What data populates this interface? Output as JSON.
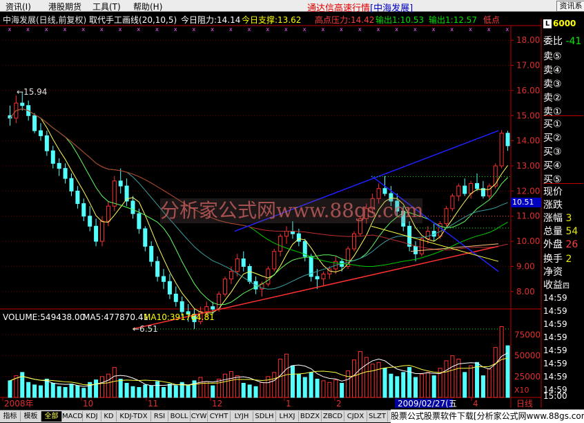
{
  "menu": {
    "items": [
      "资讯(I)",
      "港股期货",
      "工具(T)",
      "帮助(H)"
    ],
    "title_main": "通达信高速行情",
    "title_sub": "[中海发展]",
    "info_btn": "资讯系"
  },
  "chart_header": {
    "name": "中海发展(日线,前复权)",
    "indicator": "取代手工画线(20,10,5)",
    "resist_label": "今日阻力:",
    "resist_val": "14.14",
    "support_label": "今日支撑:",
    "support_val": "13.62",
    "high_label": "高点压力:",
    "high_val": "14.42",
    "out1_label": "输出1:",
    "out1_val": "10.53",
    "out2_label": "输出1:",
    "out2_val": "12.57",
    "low_label": "低点"
  },
  "right_panel": {
    "code": "6000",
    "webi_label": "委比",
    "webi_val": "-41",
    "sells": [
      "卖⑤",
      "卖④",
      "卖③",
      "卖②",
      "卖①"
    ],
    "buys": [
      "买①",
      "买②",
      "买③",
      "买④",
      "买⑤"
    ],
    "stats": [
      {
        "label": "现价",
        "val": ""
      },
      {
        "label": "涨跌",
        "val": ""
      },
      {
        "label": "涨幅",
        "val": "3"
      },
      {
        "label": "总量",
        "val": "54"
      },
      {
        "label": "外盘",
        "val": "26"
      },
      {
        "label": "换手",
        "val": "2"
      },
      {
        "label": "净资",
        "val": ""
      },
      {
        "label": "收益",
        "val": "四"
      }
    ],
    "times": [
      "14:59",
      "14:59",
      "14:59",
      "14:59",
      "14:59",
      "14:59",
      "14:59",
      "14:59",
      "15:00"
    ],
    "price_tag": "10.51"
  },
  "volume_header": {
    "vol_label": "VOLUME:",
    "vol_val": "549438.00",
    "ma5_label": "MA5:",
    "ma5_val": "477870.41",
    "ma10_label": "MA10:",
    "ma10_val": "391764.81"
  },
  "x_axis": {
    "labels": [
      "2008年",
      "10",
      "11",
      "12",
      "1",
      "2",
      "2009/02/27(五",
      "4"
    ],
    "period": "日线"
  },
  "vol_axis": {
    "ticks": [
      "75000",
      "50000",
      "25000"
    ],
    "unit": "X10"
  },
  "tabs": [
    "指标",
    "模板",
    "全部",
    "MACD",
    "KDJ",
    "KD",
    "KDJ-TDX",
    "RSI",
    "BOLL",
    "CYW",
    "CYHT",
    "LYJH",
    "SDLH",
    "LHXJ",
    "BDZX",
    "ZBCD",
    "CJDX",
    "SLZT"
  ],
  "ad_text": "股票公式股票软件下载[分析家公式网www.88gs.com]",
  "watermark_text": "分析家公式网www.88gs.com",
  "chart_data": {
    "type": "candlestick",
    "title": "中海发展(日线,前复权)",
    "ylim": [
      7.5,
      18.5
    ],
    "yticks": [
      18,
      17,
      16,
      15,
      14,
      13,
      12,
      11,
      10,
      9,
      8
    ],
    "annotations": [
      {
        "text": "15.94",
        "kind": "high"
      },
      {
        "text": "6.51",
        "kind": "low"
      }
    ],
    "ohlc": [
      [
        15.0,
        15.4,
        14.6,
        14.9
      ],
      [
        14.9,
        15.8,
        14.7,
        15.5
      ],
      [
        15.5,
        15.94,
        15.2,
        15.4
      ],
      [
        15.4,
        15.6,
        14.8,
        15.0
      ],
      [
        15.0,
        15.1,
        14.3,
        14.4
      ],
      [
        14.4,
        14.7,
        14.0,
        14.2
      ],
      [
        14.2,
        14.4,
        13.4,
        13.6
      ],
      [
        13.6,
        13.8,
        12.9,
        13.1
      ],
      [
        13.1,
        13.3,
        12.6,
        12.9
      ],
      [
        12.9,
        13.1,
        12.3,
        12.5
      ],
      [
        12.5,
        12.7,
        11.8,
        12.0
      ],
      [
        12.0,
        12.2,
        11.3,
        11.5
      ],
      [
        11.5,
        11.7,
        10.8,
        11.0
      ],
      [
        11.0,
        11.4,
        10.4,
        10.6
      ],
      [
        10.6,
        10.9,
        9.8,
        10.0
      ],
      [
        10.0,
        11.0,
        9.8,
        10.8
      ],
      [
        10.8,
        11.6,
        10.6,
        11.4
      ],
      [
        11.4,
        12.6,
        11.2,
        12.4
      ],
      [
        12.4,
        12.9,
        11.9,
        12.2
      ],
      [
        12.2,
        12.5,
        11.4,
        11.6
      ],
      [
        11.6,
        11.8,
        10.9,
        11.1
      ],
      [
        11.1,
        11.3,
        10.3,
        10.5
      ],
      [
        10.5,
        10.6,
        9.6,
        9.8
      ],
      [
        9.8,
        10.0,
        9.0,
        9.2
      ],
      [
        9.2,
        9.4,
        8.4,
        8.6
      ],
      [
        8.6,
        8.9,
        8.1,
        8.4
      ],
      [
        8.4,
        8.7,
        7.7,
        7.9
      ],
      [
        7.9,
        8.2,
        7.4,
        7.6
      ],
      [
        7.6,
        7.8,
        7.0,
        7.2
      ],
      [
        7.2,
        7.5,
        6.8,
        7.1
      ],
      [
        7.1,
        7.3,
        6.51,
        6.8
      ],
      [
        6.8,
        7.4,
        6.7,
        7.2
      ],
      [
        7.2,
        7.6,
        7.0,
        7.4
      ],
      [
        7.4,
        7.6,
        7.1,
        7.3
      ],
      [
        7.3,
        8.0,
        7.2,
        7.9
      ],
      [
        7.9,
        8.6,
        7.8,
        8.5
      ],
      [
        8.5,
        9.0,
        8.3,
        8.8
      ],
      [
        8.8,
        9.5,
        8.6,
        9.3
      ],
      [
        9.3,
        9.6,
        8.8,
        9.0
      ],
      [
        9.0,
        9.1,
        8.3,
        8.4
      ],
      [
        8.4,
        8.6,
        7.9,
        8.1
      ],
      [
        8.1,
        8.4,
        7.8,
        8.3
      ],
      [
        8.3,
        9.0,
        8.2,
        8.9
      ],
      [
        8.9,
        9.7,
        8.8,
        9.6
      ],
      [
        9.6,
        10.3,
        9.4,
        10.2
      ],
      [
        10.2,
        10.6,
        9.9,
        10.4
      ],
      [
        10.4,
        10.8,
        10.1,
        10.3
      ],
      [
        10.3,
        10.5,
        9.8,
        10.0
      ],
      [
        10.0,
        10.1,
        9.2,
        9.4
      ],
      [
        9.4,
        9.5,
        8.4,
        8.6
      ],
      [
        8.6,
        8.9,
        8.1,
        8.5
      ],
      [
        8.5,
        8.8,
        8.2,
        8.7
      ],
      [
        8.7,
        9.0,
        8.5,
        8.9
      ],
      [
        8.9,
        9.4,
        8.7,
        9.2
      ],
      [
        9.2,
        9.3,
        8.8,
        9.0
      ],
      [
        9.0,
        9.8,
        8.9,
        9.7
      ],
      [
        9.7,
        10.4,
        9.6,
        10.3
      ],
      [
        10.3,
        11.0,
        10.2,
        10.9
      ],
      [
        10.9,
        11.5,
        10.7,
        11.3
      ],
      [
        11.3,
        11.9,
        11.1,
        11.7
      ],
      [
        11.7,
        12.3,
        11.5,
        12.1
      ],
      [
        12.1,
        12.6,
        11.8,
        11.9
      ],
      [
        11.9,
        12.2,
        11.4,
        11.6
      ],
      [
        11.6,
        11.9,
        11.0,
        11.2
      ],
      [
        11.2,
        11.4,
        10.4,
        10.6
      ],
      [
        10.6,
        10.8,
        9.6,
        9.8
      ],
      [
        9.8,
        10.0,
        9.2,
        9.5
      ],
      [
        9.5,
        10.2,
        9.4,
        10.1
      ],
      [
        10.1,
        10.6,
        9.9,
        10.4
      ],
      [
        10.4,
        10.7,
        10.0,
        10.2
      ],
      [
        10.2,
        10.8,
        10.1,
        10.7
      ],
      [
        10.7,
        11.4,
        10.6,
        11.3
      ],
      [
        11.3,
        11.9,
        11.2,
        11.8
      ],
      [
        11.8,
        12.3,
        11.6,
        12.2
      ],
      [
        12.2,
        12.5,
        11.8,
        11.9
      ],
      [
        11.9,
        12.4,
        11.7,
        12.3
      ],
      [
        12.3,
        12.7,
        12.0,
        12.1
      ],
      [
        12.1,
        12.4,
        11.7,
        11.8
      ],
      [
        11.8,
        12.3,
        11.7,
        12.2
      ],
      [
        12.2,
        13.1,
        12.1,
        13.0
      ],
      [
        13.0,
        14.42,
        12.9,
        14.3
      ],
      [
        14.3,
        14.4,
        13.6,
        13.8
      ]
    ],
    "volume": [
      20000,
      26000,
      30000,
      18000,
      15000,
      14000,
      22000,
      17000,
      13000,
      12000,
      16000,
      14000,
      11000,
      18000,
      21000,
      25000,
      28000,
      36000,
      22000,
      17000,
      13000,
      12000,
      15000,
      14000,
      19000,
      12000,
      16000,
      14000,
      18000,
      15000,
      20000,
      24000,
      19000,
      14000,
      22000,
      28000,
      31000,
      26000,
      17000,
      15000,
      13000,
      18000,
      25000,
      30000,
      46000,
      52000,
      38000,
      28000,
      24000,
      30000,
      22000,
      20000,
      18000,
      21000,
      17000,
      32000,
      45000,
      55000,
      48000,
      40000,
      42000,
      35000,
      28000,
      25000,
      30000,
      36000,
      24000,
      28000,
      30000,
      26000,
      35000,
      44000,
      50000,
      46000,
      30000,
      38000,
      42000,
      26000,
      34000,
      60000,
      85000,
      62000
    ],
    "vol_ylim": [
      0,
      92000
    ]
  }
}
